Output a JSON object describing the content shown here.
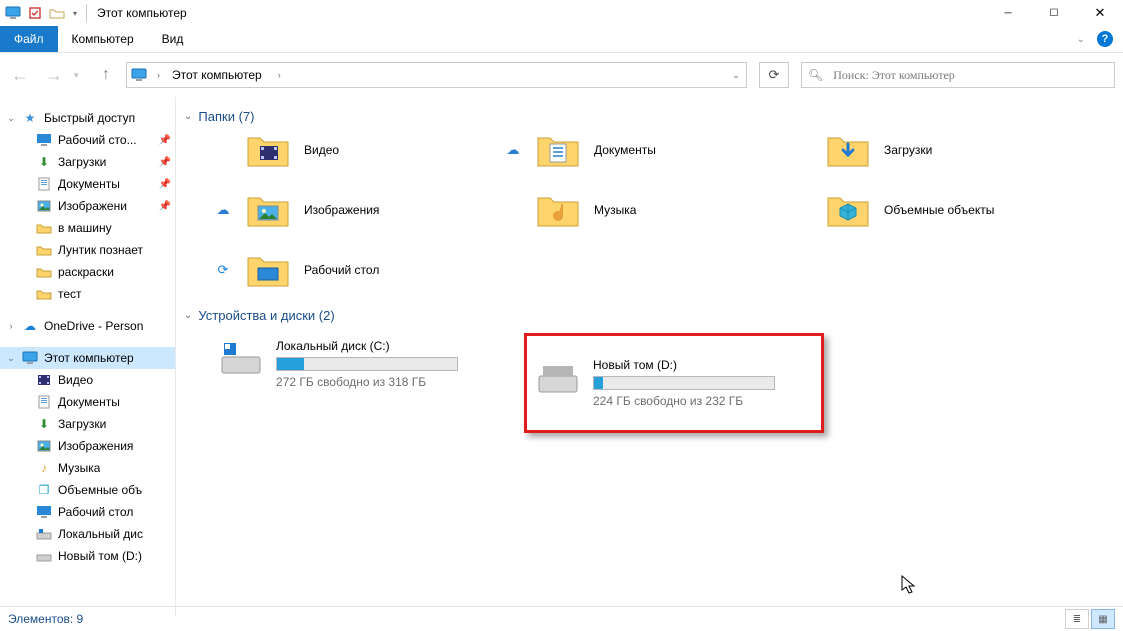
{
  "window": {
    "title": "Этот компьютер"
  },
  "ribbon": {
    "file": "Файл",
    "computer": "Компьютер",
    "view": "Вид"
  },
  "address": {
    "crumb": "Этот компьютер"
  },
  "search": {
    "placeholder": "Поиск: Этот компьютер"
  },
  "sidebar": {
    "quick": {
      "label": "Быстрый доступ"
    },
    "desktop_p": {
      "label": "Рабочий сто..."
    },
    "downloads_p": {
      "label": "Загрузки"
    },
    "documents_p": {
      "label": "Документы"
    },
    "pictures_p": {
      "label": "Изображени"
    },
    "car": {
      "label": "в машину"
    },
    "luntik": {
      "label": "Лунтик познает"
    },
    "coloring": {
      "label": "раскраски"
    },
    "test": {
      "label": "тест"
    },
    "onedrive": {
      "label": "OneDrive - Person"
    },
    "this_pc": {
      "label": "Этот компьютер"
    },
    "video": {
      "label": "Видео"
    },
    "documents": {
      "label": "Документы"
    },
    "downloads": {
      "label": "Загрузки"
    },
    "pictures": {
      "label": "Изображения"
    },
    "music": {
      "label": "Музыка"
    },
    "objects3d": {
      "label": "Объемные объ"
    },
    "desktop": {
      "label": "Рабочий стол"
    },
    "local_c": {
      "label": "Локальный дис"
    },
    "local_d": {
      "label": "Новый том (D:)"
    }
  },
  "groups": {
    "folders": {
      "title": "Папки (7)"
    },
    "drives": {
      "title": "Устройства и диски (2)"
    }
  },
  "folders": {
    "video": {
      "label": "Видео"
    },
    "documents": {
      "label": "Документы"
    },
    "downloads": {
      "label": "Загрузки"
    },
    "pictures": {
      "label": "Изображения"
    },
    "music": {
      "label": "Музыка"
    },
    "objects3d": {
      "label": "Объемные объекты"
    },
    "desktop": {
      "label": "Рабочий стол"
    }
  },
  "drives": {
    "c": {
      "name": "Локальный диск (C:)",
      "free": "272 ГБ свободно из 318 ГБ",
      "fill_pct": 15
    },
    "d": {
      "name": "Новый том (D:)",
      "free": "224 ГБ свободно из 232 ГБ",
      "fill_pct": 5
    }
  },
  "status": {
    "items_label": "Элементов:",
    "items_count": "9"
  }
}
